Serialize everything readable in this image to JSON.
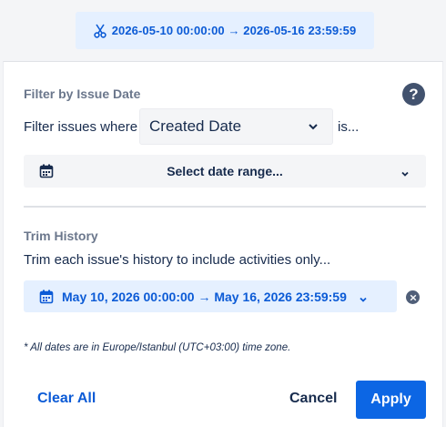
{
  "top_filter": {
    "icon": "scissors-icon",
    "label": "2026-05-10 00:00:00 → 2026-05-16 23:59:59"
  },
  "filter_section": {
    "title": "Filter by Issue Date",
    "help_glyph": "?",
    "prefix": "Filter issues where",
    "field_select": {
      "value": "Created Date"
    },
    "suffix": "is...",
    "date_range_button": {
      "label": "Select date range..."
    }
  },
  "trim_section": {
    "title": "Trim History",
    "description": "Trim each issue's history to include activities only...",
    "range_label": "May 10, 2026 00:00:00 → May 16, 2026 23:59:59"
  },
  "timezone_note": "* All dates are in Europe/Istanbul (UTC+03:00) time zone.",
  "footer": {
    "clear_all": "Clear All",
    "cancel": "Cancel",
    "apply": "Apply"
  },
  "colors": {
    "accent": "#0c66e4",
    "link": "#0c5bd6",
    "chip_bg": "#e5f0ff",
    "muted_title": "#6b778c"
  }
}
